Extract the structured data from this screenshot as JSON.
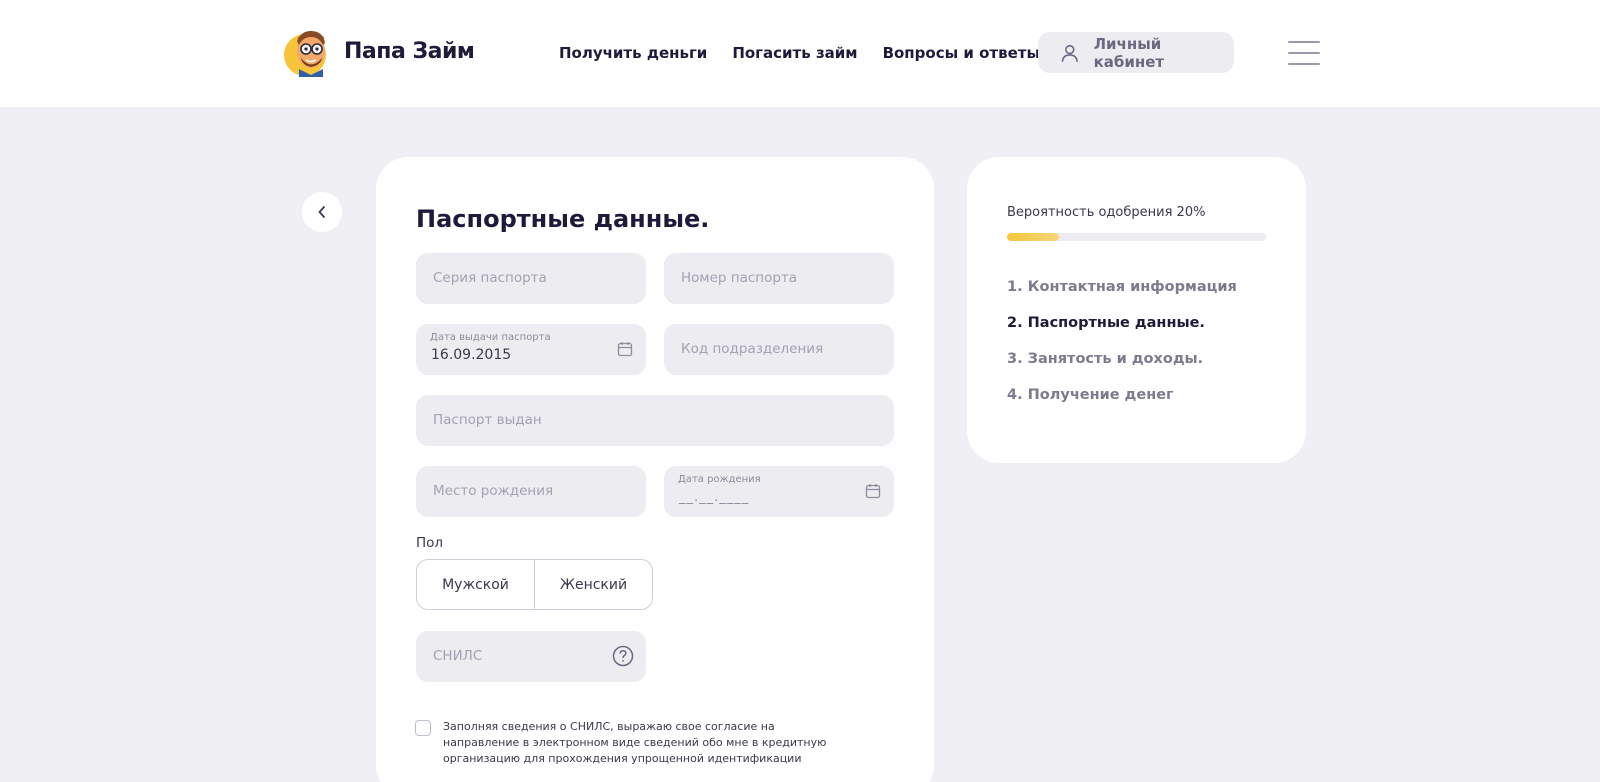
{
  "brand": {
    "name": "Папа Займ"
  },
  "nav": [
    {
      "label": "Получить деньги"
    },
    {
      "label": "Погасить займ"
    },
    {
      "label": "Вопросы и ответы"
    }
  ],
  "cabinet": {
    "label": "Личный кабинет"
  },
  "form": {
    "title": "Паспортные данные.",
    "passport_series": {
      "placeholder": "Серия паспорта"
    },
    "passport_number": {
      "placeholder": "Номер паспорта"
    },
    "issue_date": {
      "label": "Дата выдачи паспорта",
      "value": "16.09.2015"
    },
    "division_code": {
      "placeholder": "Код подразделения"
    },
    "issued_by": {
      "placeholder": "Паспорт выдан"
    },
    "birth_place": {
      "placeholder": "Место рождения"
    },
    "birth_date": {
      "label": "Дата рождения",
      "mask": "__.__.____"
    },
    "gender": {
      "label": "Пол",
      "options": [
        "Мужской",
        "Женский"
      ]
    },
    "snils": {
      "placeholder": "СНИЛС"
    },
    "consent": {
      "checked": false,
      "text": "Заполняя сведения о СНИЛС, выражаю свое согласие на направление в электронном виде сведений обо мне в кредитную организацию для прохождения упрощенной идентификации"
    }
  },
  "progress": {
    "label": "Вероятность одобрения 20%",
    "value": 0.2,
    "steps": [
      {
        "label": "1. Контактная информация",
        "active": false
      },
      {
        "label": "2. Паспортные данные.",
        "active": true
      },
      {
        "label": "3. Занятость и доходы.",
        "active": false
      },
      {
        "label": "4. Получение денег",
        "active": false
      }
    ]
  },
  "colors": {
    "accent": "#f5c53a",
    "text": "#1d1a3a",
    "field_bg": "#ececf1",
    "page_bg": "#f0f0f4"
  },
  "icons": [
    "logo-mascot-icon",
    "user-icon",
    "menu-icon",
    "chevron-left-icon",
    "calendar-icon",
    "question-icon"
  ]
}
